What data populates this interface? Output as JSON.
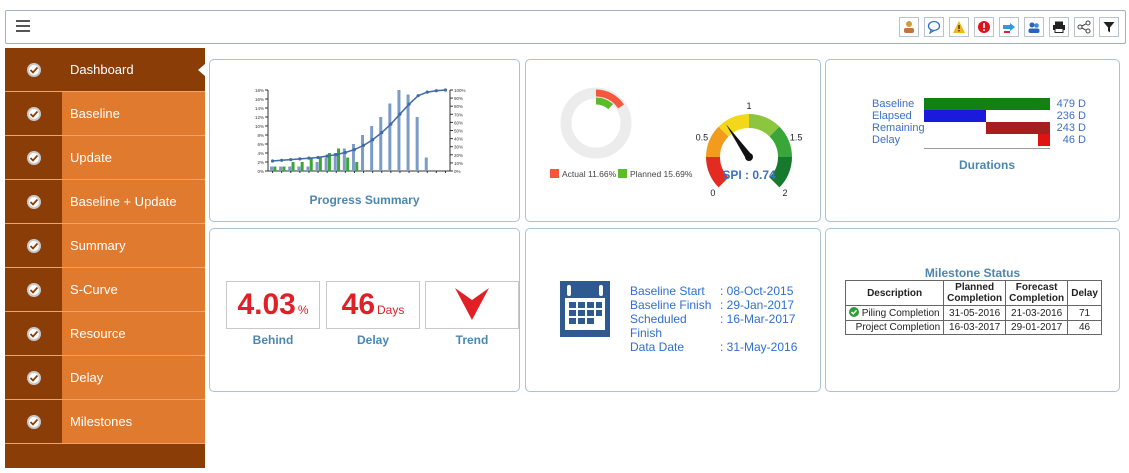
{
  "toolbar": {
    "icons": [
      "user-icon",
      "comment-icon",
      "warning-icon",
      "alert-icon",
      "export-icon",
      "users-icon",
      "print-icon",
      "share-icon",
      "filter-icon"
    ]
  },
  "sidebar": {
    "items": [
      {
        "label": "Dashboard",
        "active": true
      },
      {
        "label": "Baseline"
      },
      {
        "label": "Update"
      },
      {
        "label": "Baseline + Update"
      },
      {
        "label": "Summary"
      },
      {
        "label": "S-Curve"
      },
      {
        "label": "Resource"
      },
      {
        "label": "Delay"
      },
      {
        "label": "Milestones"
      }
    ]
  },
  "progress_summary": {
    "title": "Progress Summary",
    "chart_data": {
      "type": "bar",
      "yticks_left": [
        "18%",
        "16%",
        "14%",
        "12%",
        "10%",
        "8%",
        "6%",
        "4%",
        "2%",
        "0%"
      ],
      "yticks_right": [
        "100%",
        "90%",
        "80%",
        "70%",
        "60%",
        "50%",
        "40%",
        "30%",
        "20%",
        "10%",
        "0%"
      ],
      "series": [
        {
          "color": "#7a9cc6",
          "values": [
            1,
            1,
            1,
            1,
            1,
            2,
            3,
            4,
            5,
            6,
            8,
            10,
            12,
            15,
            18,
            17,
            12,
            3,
            0,
            0
          ]
        },
        {
          "color": "#3aa63a",
          "values": [
            1,
            1,
            2,
            2,
            3,
            3,
            4,
            5,
            3,
            2,
            0,
            0,
            0,
            0,
            0,
            0,
            0,
            0,
            0,
            0
          ]
        },
        {
          "color": "#3f6aa6",
          "values": [
            0,
            1,
            2,
            3,
            4,
            5,
            7,
            9,
            12,
            16,
            22,
            30,
            40,
            52,
            66,
            80,
            92,
            97,
            99,
            100
          ]
        }
      ]
    }
  },
  "spi": {
    "legend_actual": "Actual 11.66%",
    "legend_planned": "Planned 15.69%",
    "actual_pct": 11.66,
    "planned_pct": 15.69,
    "gauge_ticks": [
      "0",
      "0.5",
      "1",
      "1.5",
      "2"
    ],
    "value": 0.74,
    "label": "SPI : 0.74"
  },
  "durations": {
    "title": "Durations",
    "max": 479,
    "rows": [
      {
        "name": "Baseline",
        "value": 479,
        "text": "479 D",
        "color": "#128012",
        "start": 0
      },
      {
        "name": "Elapsed",
        "value": 236,
        "text": "236 D",
        "color": "#1a1adc",
        "start": 0
      },
      {
        "name": "Remaining",
        "value": 243,
        "text": "243 D",
        "color": "#a61e1e",
        "start": 236
      },
      {
        "name": "Delay",
        "value": 46,
        "text": "46 D",
        "color": "#e21212",
        "start": 433
      }
    ]
  },
  "status": {
    "behind_value": "4.03",
    "behind_unit": "%",
    "behind_label": "Behind",
    "delay_value": "46",
    "delay_unit": "Days",
    "delay_label": "Delay",
    "trend_label": "Trend"
  },
  "schedule": {
    "rows": [
      {
        "k": "Baseline Start",
        "v": ": 08-Oct-2015"
      },
      {
        "k": "Baseline Finish",
        "v": ": 29-Jan-2017"
      },
      {
        "k": "Scheduled Finish",
        "v": ": 16-Mar-2017"
      },
      {
        "k": "Data Date",
        "v": ": 31-May-2016"
      }
    ]
  },
  "milestones": {
    "title": "Milestone Status",
    "headers": [
      "Description",
      "Planned Completion",
      "Forecast Completion",
      "Delay"
    ],
    "rows": [
      [
        "Piling Completion",
        "31-05-2016",
        "21-03-2016",
        "71"
      ],
      [
        "Project Completion",
        "16-03-2017",
        "29-01-2017",
        "46"
      ]
    ]
  }
}
